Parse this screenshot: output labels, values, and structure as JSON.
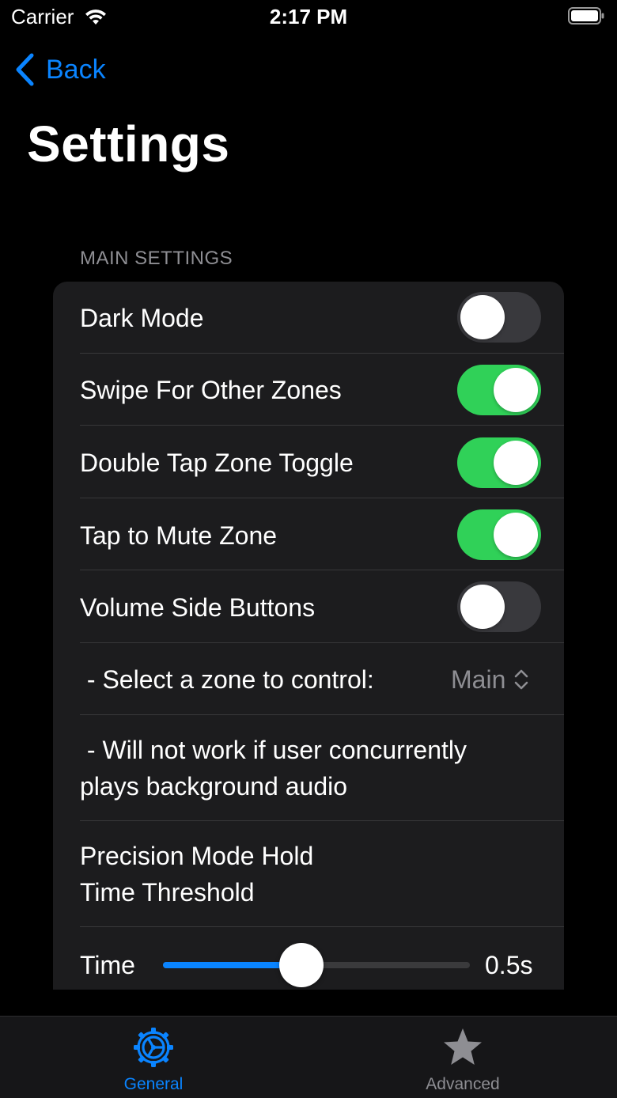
{
  "status_bar": {
    "carrier": "Carrier",
    "time": "2:17 PM"
  },
  "nav": {
    "back_label": "Back",
    "title": "Settings"
  },
  "main_settings": {
    "header": "MAIN SETTINGS",
    "rows": {
      "dark_mode": {
        "label": "Dark Mode",
        "on": false
      },
      "swipe_zones": {
        "label": "Swipe For Other Zones",
        "on": true
      },
      "double_tap": {
        "label": "Double Tap Zone Toggle",
        "on": true
      },
      "tap_mute": {
        "label": "Tap to Mute Zone",
        "on": true
      },
      "volume_buttons": {
        "label": "Volume Side Buttons",
        "on": false
      },
      "select_zone": {
        "label": " - Select a zone to control:",
        "value": "Main"
      },
      "note": {
        "line1": " - Will not work if user concurrently",
        "line2": "plays background audio"
      },
      "precision": {
        "line1": "Precision Mode Hold",
        "line2": "Time Threshold"
      },
      "time": {
        "label": "Time",
        "value_text": "0.5s",
        "fraction": 0.45
      }
    }
  },
  "tab_bar": {
    "tabs": [
      {
        "label": "General",
        "icon": "gear-icon",
        "active": true
      },
      {
        "label": "Advanced",
        "icon": "star-icon",
        "active": false
      }
    ]
  },
  "colors": {
    "accent": "#0a84ff",
    "toggle_on": "#30d158",
    "toggle_off": "#39393d",
    "group_bg": "#1c1c1e",
    "secondary_text": "#8e8e93"
  }
}
